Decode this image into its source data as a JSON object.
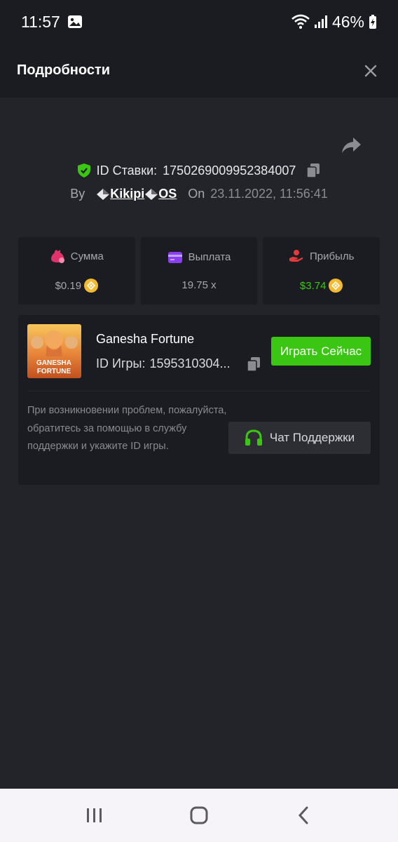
{
  "status_bar": {
    "time": "11:57",
    "battery": "46%"
  },
  "header": {
    "title": "Подробности"
  },
  "bet": {
    "id_label": "ID Ставки:",
    "id_value": "1750269009952384007",
    "by_label": "By",
    "username": "Kikipi",
    "username_suffix": "OS",
    "on_label": "On",
    "datetime": "23.11.2022, 11:56:41"
  },
  "stats": [
    {
      "label": "Сумма",
      "value": "$0.19",
      "icon": "money-bag-icon",
      "color": "#e0336b"
    },
    {
      "label": "Выплата",
      "value": "19.75 x",
      "icon": "card-icon",
      "color": "#8b3ff2"
    },
    {
      "label": "Прибыль",
      "value": "$3.74",
      "icon": "hand-coin-icon",
      "color": "#e53a3a"
    }
  ],
  "game": {
    "name": "Ganesha Fortune",
    "id_label": "ID Игры:",
    "id_value": "1595310304...",
    "play_label": "Играть Сейчас",
    "thumb_title_1": "GANESHA",
    "thumb_title_2": "FORTUNE",
    "help_text": "При возникновении проблем, пожалуйста, обратитесь за помощью в службу поддержки и укажите ID игры.",
    "support_label": "Чат Поддержки"
  },
  "colors": {
    "accent_green": "#3cc614",
    "background": "#232429",
    "panel": "#1b1c21",
    "coin": "#f3ba2f"
  }
}
